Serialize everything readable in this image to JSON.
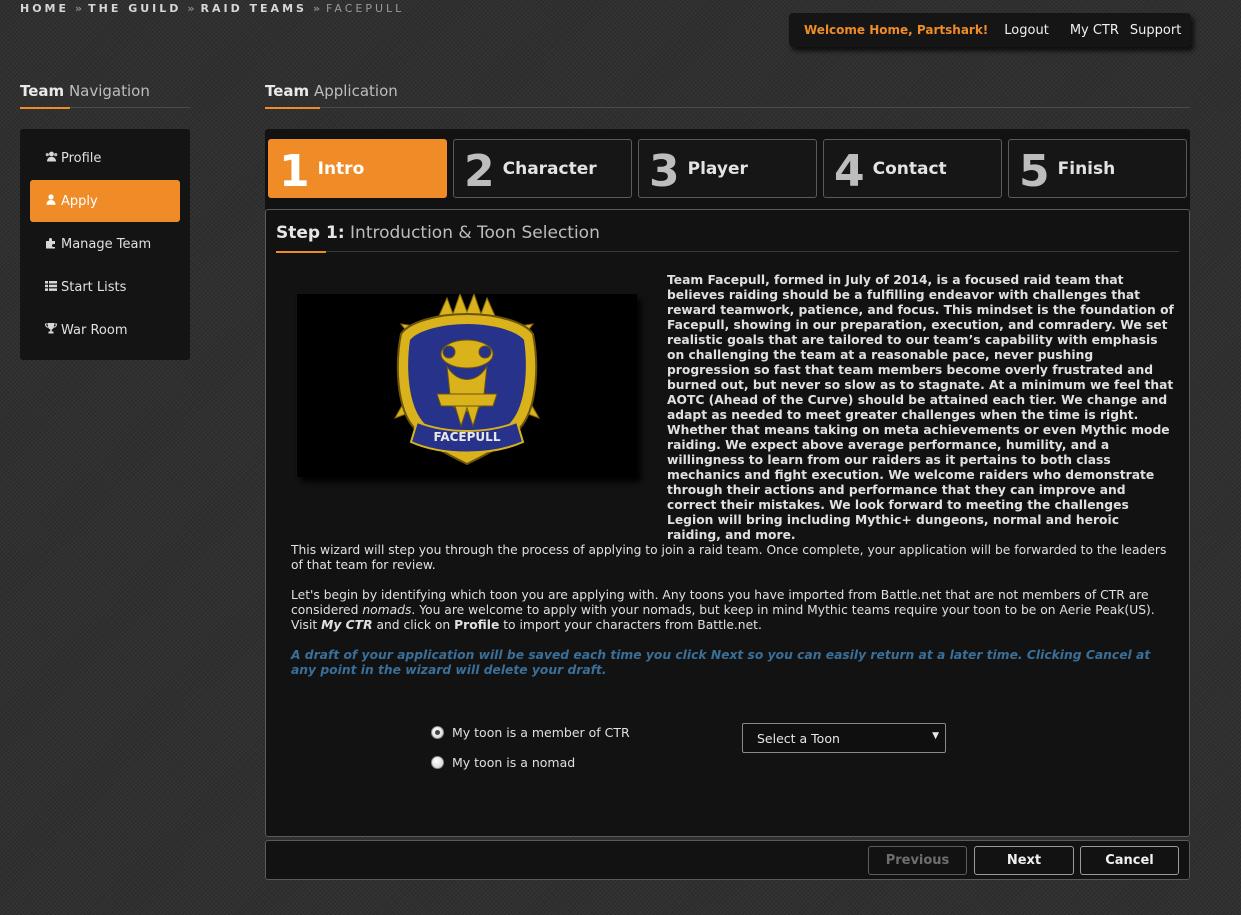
{
  "breadcrumb": {
    "items": [
      "HOME",
      "THE GUILD",
      "RAID TEAMS"
    ],
    "separator": "»",
    "current": "FACEPULL"
  },
  "topbar": {
    "welcome": "Welcome Home, Partshark!",
    "logout": "Logout",
    "my_ctr": "My CTR",
    "support": "Support"
  },
  "sidebar": {
    "title_bold": "Team",
    "title_rest": " Navigation",
    "items": [
      {
        "label": "Profile",
        "icon": "users-icon"
      },
      {
        "label": "Apply",
        "icon": "user-icon",
        "active": true
      },
      {
        "label": "Manage Team",
        "icon": "puzzle-icon"
      },
      {
        "label": "Start Lists",
        "icon": "list-icon"
      },
      {
        "label": "War Room",
        "icon": "trophy-icon"
      }
    ]
  },
  "main": {
    "title_bold": "Team",
    "title_rest": " Application"
  },
  "steps": [
    {
      "num": "1",
      "label": "Intro",
      "active": true
    },
    {
      "num": "2",
      "label": "Character"
    },
    {
      "num": "3",
      "label": "Player"
    },
    {
      "num": "4",
      "label": "Contact"
    },
    {
      "num": "5",
      "label": "Finish"
    }
  ],
  "panel": {
    "title_bold": "Step 1:",
    "title_rest": " Introduction & Toon Selection",
    "logo_text": "FACEPULL",
    "intro": "Team Facepull, formed in July of 2014, is a focused raid team that believes raiding should be a fulfilling endeavor with challenges that reward teamwork, patience, and focus. This mindset is the foundation of Facepull, showing in our preparation, execution, and comradery. We set realistic goals that are tailored to our team’s capability with emphasis on challenging the team at a reasonable pace, never pushing progression so fast that team members become overly frustrated and burned out, but never so slow as to stagnate. At a minimum we feel that AOTC (Ahead of the Curve) should be attained each tier. We change and adapt as needed to meet greater challenges when the time is right. Whether that means taking on meta achievements or even Mythic mode raiding. We expect above average performance, humility, and a willingness to learn from our raiders as it pertains to both class mechanics and fight execution. We welcome raiders who demonstrate through their actions and performance that they can improve and correct their mistakes. We look forward to meeting the challenges Legion will bring including Mythic+ dungeons, normal and heroic raiding, and more.",
    "wizard_note": "This wizard will step you through the process of applying to join a raid team. Once complete, your application will be forwarded to the leaders of that team for review.",
    "toon_p1": "Let's begin by identifying which toon you are applying with. Any toons you have imported from Battle.net that are not members of CTR are considered ",
    "toon_nomads": "nomads",
    "toon_p2": ". You are welcome to apply with your nomads, but keep in mind Mythic teams require your toon to be on Aerie Peak(US). Visit ",
    "toon_myctr": "My CTR",
    "toon_p3": " and click on ",
    "toon_profile": "Profile",
    "toon_p4": " to import your characters from Battle.net.",
    "draft_note": "A draft of your application will be saved each time you click Next so you can easily return at a later time. Clicking Cancel at any point in the wizard will delete your draft.",
    "radio_member": "My toon is a member of CTR",
    "radio_nomad": "My toon is a nomad",
    "select_value": "Select a Toon"
  },
  "footer": {
    "previous": "Previous",
    "next": "Next",
    "cancel": "Cancel"
  },
  "colors": {
    "accent": "#ef8c27",
    "draft_text": "#3a6f99",
    "panel_bg": "#121212"
  }
}
